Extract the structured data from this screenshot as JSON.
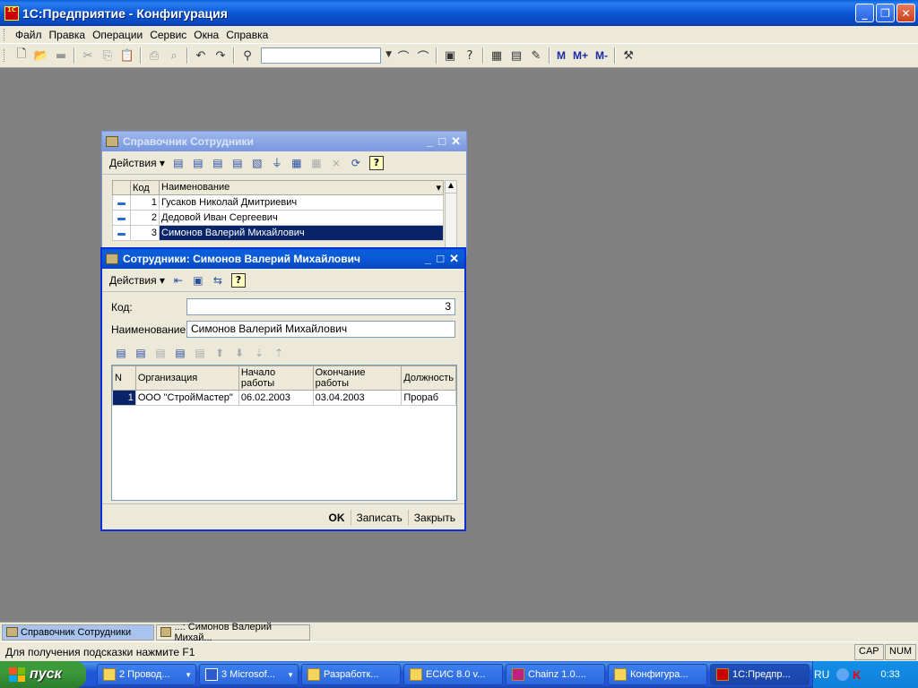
{
  "app": {
    "title": "1С:Предприятие - Конфигурация",
    "icon": "1c-logo-icon",
    "icon_text": "1C"
  },
  "window_controls": {
    "minimize": "_",
    "maximize": "❐",
    "close": "✕"
  },
  "menu": [
    "Файл",
    "Правка",
    "Операции",
    "Сервис",
    "Окна",
    "Справка"
  ],
  "toolbar": {
    "icons": [
      "new-document-icon",
      "open-icon",
      "save-icon",
      "cut-icon",
      "copy-icon",
      "paste-icon",
      "print-icon",
      "preview-icon",
      "undo-icon",
      "redo-icon",
      "find-icon"
    ],
    "search_value": "",
    "memory_buttons": [
      "M",
      "M+",
      "M-"
    ]
  },
  "catalog_window": {
    "title": "Справочник Сотрудники",
    "actions_label": "Действия",
    "columns": [
      "Код",
      "Наименование"
    ],
    "rows": [
      {
        "code": "1",
        "name": "Гусаков Николай Дмитриевич"
      },
      {
        "code": "2",
        "name": "Дедовой Иван Сергеевич"
      },
      {
        "code": "3",
        "name": "Симонов Валерий Михайлович"
      }
    ]
  },
  "item_window": {
    "title": "Сотрудники: Симонов Валерий Михайлович",
    "actions_label": "Действия",
    "code_label": "Код:",
    "code_value": "3",
    "name_label": "Наименование:",
    "name_value": "Симонов Валерий Михайлович",
    "table_columns": [
      "N",
      "Организация",
      "Начало работы",
      "Окончание работы",
      "Должность"
    ],
    "table_rows": [
      {
        "n": "1",
        "org": "ООО \"СтройМастер\"",
        "start": "06.02.2003",
        "end": "03.04.2003",
        "position": "Прораб"
      }
    ],
    "buttons": {
      "ok": "OK",
      "save": "Записать",
      "close": "Закрыть"
    }
  },
  "window_tabs": [
    "Справочник Сотрудники",
    "...: Симонов Валерий Михай..."
  ],
  "status": {
    "hint": "Для получения подсказки нажмите F1",
    "cap": "CAP",
    "num": "NUM"
  },
  "taskbar": {
    "start_label": "пуск",
    "tasks": [
      {
        "label": "2 Провод...",
        "dropdown": true
      },
      {
        "label": "3 Microsof...",
        "dropdown": true
      },
      {
        "label": "Разработк...",
        "dropdown": false
      },
      {
        "label": "ЕСИС 8.0 v...",
        "dropdown": false
      },
      {
        "label": "Chainz 1.0....",
        "dropdown": false
      },
      {
        "label": "Конфигура...",
        "dropdown": false
      },
      {
        "label": "1С:Предпр...",
        "dropdown": false,
        "active": true
      }
    ],
    "lang": "RU",
    "clock": "0:33"
  }
}
